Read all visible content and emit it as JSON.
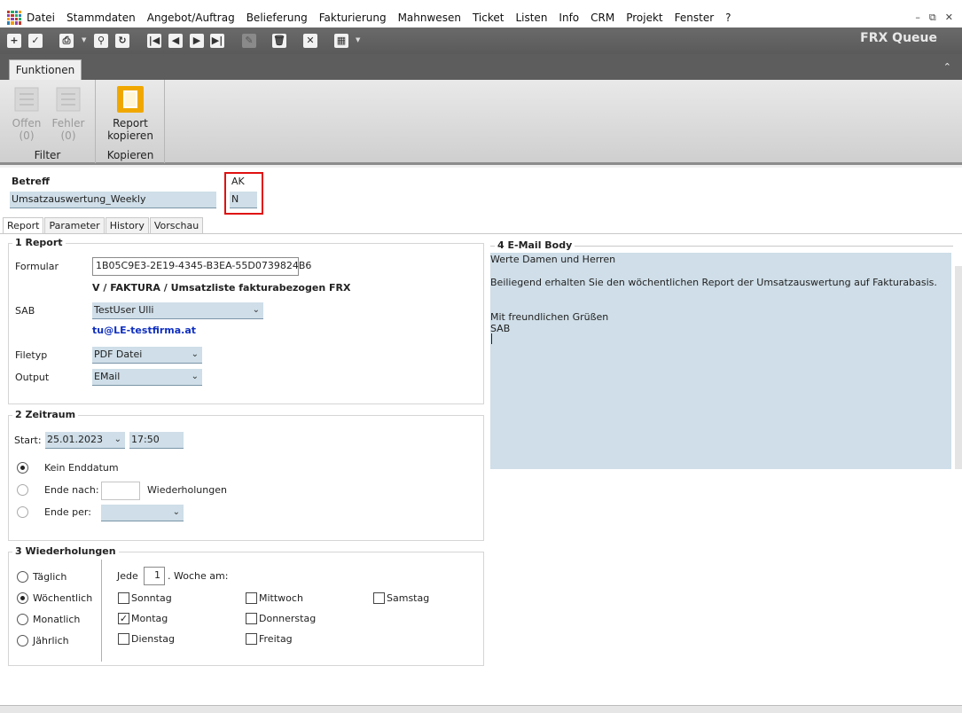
{
  "menu": [
    "Datei",
    "Stammdaten",
    "Angebot/Auftrag",
    "Belieferung",
    "Fakturierung",
    "Mahnwesen",
    "Ticket",
    "Listen",
    "Info",
    "CRM",
    "Projekt",
    "Fenster",
    "?"
  ],
  "window_title": "FRX Queue",
  "ribbon": {
    "tab": "Funktionen",
    "filter_group": "Filter",
    "offen_label": "Offen",
    "offen_count": "(0)",
    "fehler_label": "Fehler",
    "fehler_count": "(0)",
    "report_label_1": "Report",
    "report_label_2": "kopieren",
    "kopieren_group": "Kopieren"
  },
  "header": {
    "betreff_label": "Betreff",
    "betreff_value": "Umsatzauswertung_Weekly",
    "ak_label": "AK",
    "ak_value": "N"
  },
  "tabs": [
    "Report",
    "Parameter",
    "History",
    "Vorschau"
  ],
  "report": {
    "title": "1 Report",
    "formular_label": "Formular",
    "formular_value": "1B05C9E3-2E19-4345-B3EA-55D0739824B6",
    "formular_desc": "V / FAKTURA / Umsatzliste fakturabezogen FRX",
    "sab_label": "SAB",
    "sab_value": "TestUser Ulli",
    "email": "tu@LE-testfirma.at",
    "filetyp_label": "Filetyp",
    "filetyp_value": "PDF Datei",
    "output_label": "Output",
    "output_value": "EMail"
  },
  "zeitraum": {
    "title": "2 Zeitraum",
    "start_label": "Start:",
    "start_date": "25.01.2023",
    "start_time": "17:50",
    "kein_enddatum": "Kein Enddatum",
    "ende_nach": "Ende nach:",
    "wiederholungen_label": "Wiederholungen",
    "ende_per": "Ende per:"
  },
  "wiederholungen": {
    "title": "3 Wiederholungen",
    "taeglich": "Täglich",
    "woechentlich": "Wöchentlich",
    "monatlich": "Monatlich",
    "jaehrlich": "Jährlich",
    "jede_label": "Jede",
    "jede_value": "1",
    "woche_am": ". Woche am:",
    "sonntag": "Sonntag",
    "montag": "Montag",
    "dienstag": "Dienstag",
    "mittwoch": "Mittwoch",
    "donnerstag": "Donnerstag",
    "freitag": "Freitag",
    "samstag": "Samstag"
  },
  "email_body": {
    "title": "4 E-Mail Body",
    "line1": "Werte Damen und Herren",
    "line2": "Beiliegend erhalten Sie den wöchentlichen Report der Umsatzauswertung auf Fakturabasis.",
    "line3": "Mit freundlichen Grüßen",
    "line4": "SAB"
  },
  "colors": {
    "field_bg": "#cfdee8",
    "highlight_red": "#e01010",
    "email_blue": "#1030c0",
    "report_icon": "#f0a800"
  }
}
